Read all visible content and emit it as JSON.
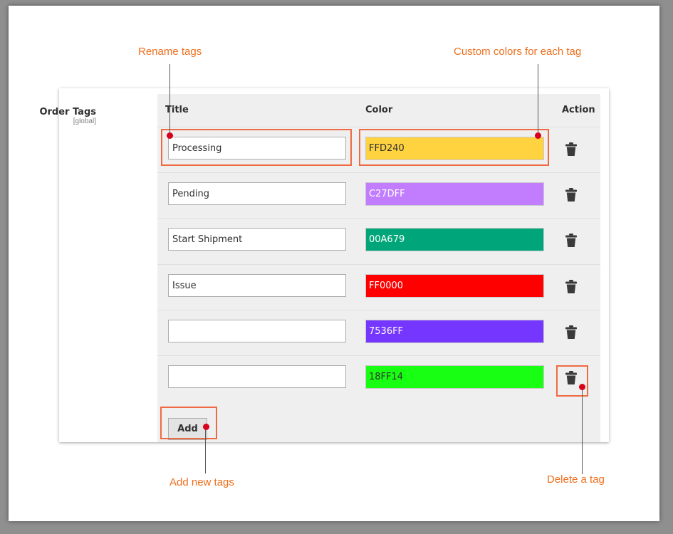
{
  "field": {
    "label": "Order Tags",
    "scope": "[global]"
  },
  "columns": {
    "title": "Title",
    "color": "Color",
    "action": "Action"
  },
  "rows": [
    {
      "title": "Processing",
      "color": "FFD240",
      "bg": "#FFD240"
    },
    {
      "title": "Pending",
      "color": "C27DFF",
      "bg": "#C27DFF"
    },
    {
      "title": "Start Shipment",
      "color": "00A679",
      "bg": "#00A679"
    },
    {
      "title": "Issue",
      "color": "FF0000",
      "bg": "#FF0000"
    },
    {
      "title": "",
      "color": "7536FF",
      "bg": "#7536FF"
    },
    {
      "title": "",
      "color": "18FF14",
      "bg": "#18FF14"
    }
  ],
  "add_label": "Add",
  "action_icon": "trash-icon",
  "callouts": {
    "rename": "Rename tags",
    "colors": "Custom colors for each tag",
    "add": "Add new tags",
    "delete": "Delete a tag"
  },
  "accent": "#ef6a43",
  "callout_color": "#ef6e1c"
}
